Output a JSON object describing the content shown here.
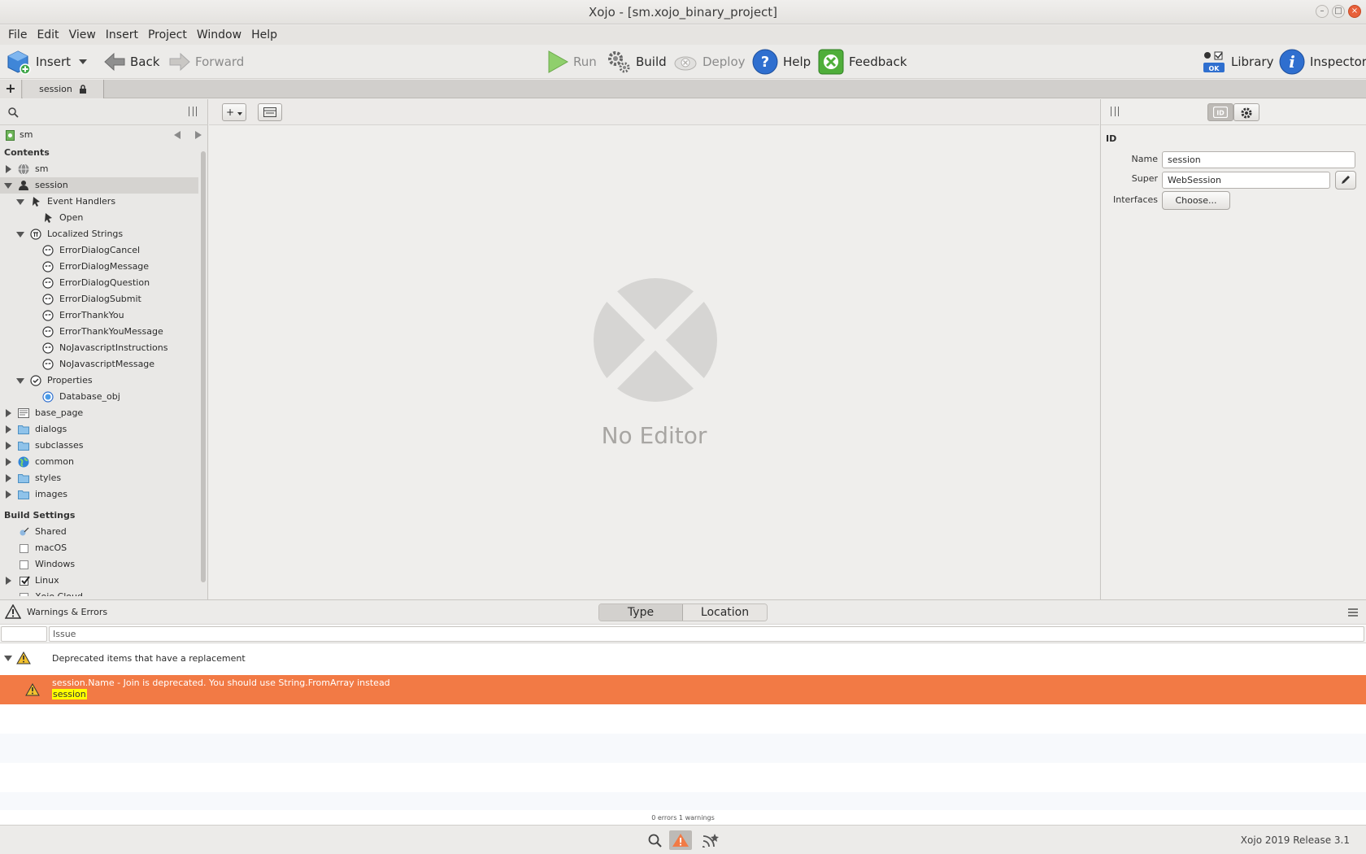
{
  "window": {
    "title": "Xojo - [sm.xojo_binary_project]"
  },
  "menubar": {
    "items": [
      "File",
      "Edit",
      "View",
      "Insert",
      "Project",
      "Window",
      "Help"
    ]
  },
  "toolbar": {
    "insert": "Insert",
    "back": "Back",
    "forward": "Forward",
    "run": "Run",
    "build": "Build",
    "deploy": "Deploy",
    "help": "Help",
    "feedback": "Feedback",
    "library": "Library",
    "inspector": "Inspector",
    "library_ok": "OK"
  },
  "tabs": {
    "new_tab": "+",
    "active": "session"
  },
  "navigator": {
    "project_name": "sm",
    "contents_header": "Contents",
    "tree": [
      {
        "label": "sm",
        "state": "collapsed",
        "indent": 0,
        "icon": "globe-icon"
      },
      {
        "label": "session",
        "state": "expanded",
        "indent": 0,
        "icon": "user-icon",
        "selected": true
      },
      {
        "label": "Event Handlers",
        "state": "expanded",
        "indent": 1,
        "icon": "event-handler-icon"
      },
      {
        "label": "Open",
        "state": "leaf",
        "indent": 2,
        "icon": "event-handler-icon"
      },
      {
        "label": "Localized Strings",
        "state": "expanded",
        "indent": 1,
        "icon": "localized-strings-icon"
      },
      {
        "label": "ErrorDialogCancel",
        "state": "leaf",
        "indent": 2,
        "icon": "string-icon"
      },
      {
        "label": "ErrorDialogMessage",
        "state": "leaf",
        "indent": 2,
        "icon": "string-icon"
      },
      {
        "label": "ErrorDialogQuestion",
        "state": "leaf",
        "indent": 2,
        "icon": "string-icon"
      },
      {
        "label": "ErrorDialogSubmit",
        "state": "leaf",
        "indent": 2,
        "icon": "string-icon"
      },
      {
        "label": "ErrorThankYou",
        "state": "leaf",
        "indent": 2,
        "icon": "string-icon"
      },
      {
        "label": "ErrorThankYouMessage",
        "state": "leaf",
        "indent": 2,
        "icon": "string-icon"
      },
      {
        "label": "NoJavascriptInstructions",
        "state": "leaf",
        "indent": 2,
        "icon": "string-icon"
      },
      {
        "label": "NoJavascriptMessage",
        "state": "leaf",
        "indent": 2,
        "icon": "string-icon"
      },
      {
        "label": "Properties",
        "state": "expanded",
        "indent": 1,
        "icon": "properties-icon"
      },
      {
        "label": "Database_obj",
        "state": "leaf",
        "indent": 2,
        "icon": "property-icon"
      },
      {
        "label": "base_page",
        "state": "collapsed",
        "indent": 0,
        "icon": "web-page-icon"
      },
      {
        "label": "dialogs",
        "state": "collapsed",
        "indent": 0,
        "icon": "folder-icon"
      },
      {
        "label": "subclasses",
        "state": "collapsed",
        "indent": 0,
        "icon": "folder-icon"
      },
      {
        "label": "common",
        "state": "collapsed",
        "indent": 0,
        "icon": "module-globe-icon"
      },
      {
        "label": "styles",
        "state": "collapsed",
        "indent": 0,
        "icon": "folder-icon"
      },
      {
        "label": "images",
        "state": "collapsed",
        "indent": 0,
        "icon": "folder-icon"
      }
    ],
    "build_settings_header": "Build Settings",
    "build_settings": [
      {
        "label": "Shared",
        "kind": "shared",
        "checked": false,
        "expandable": false
      },
      {
        "label": "macOS",
        "kind": "checkbox",
        "checked": false,
        "expandable": false
      },
      {
        "label": "Windows",
        "kind": "checkbox",
        "checked": false,
        "expandable": false
      },
      {
        "label": "Linux",
        "kind": "checkbox",
        "checked": true,
        "expandable": true
      },
      {
        "label": "Xojo Cloud",
        "kind": "checkbox",
        "checked": false,
        "expandable": false
      }
    ]
  },
  "editor": {
    "add_button": "+",
    "placeholder": "No Editor"
  },
  "inspector": {
    "section": "ID",
    "name_label": "Name",
    "name_value": "session",
    "super_label": "Super",
    "super_value": "WebSession",
    "interfaces_label": "Interfaces",
    "choose_button": "Choose..."
  },
  "issues": {
    "title": "Warnings & Errors",
    "group_by_type": "Type",
    "group_by_location": "Location",
    "column_issue": "Issue",
    "group_label": "Deprecated items that have a replacement",
    "issue_message": "session.Name - Join is deprecated.  You should use String.FromArray instead",
    "issue_location": "session",
    "summary": "0 errors 1 warnings"
  },
  "statusbar": {
    "version": "Xojo 2019 Release 3.1"
  },
  "colors": {
    "warning_row": "#f27a45",
    "highlight": "#ffff00",
    "accent_blue": "#2f6fcf"
  }
}
